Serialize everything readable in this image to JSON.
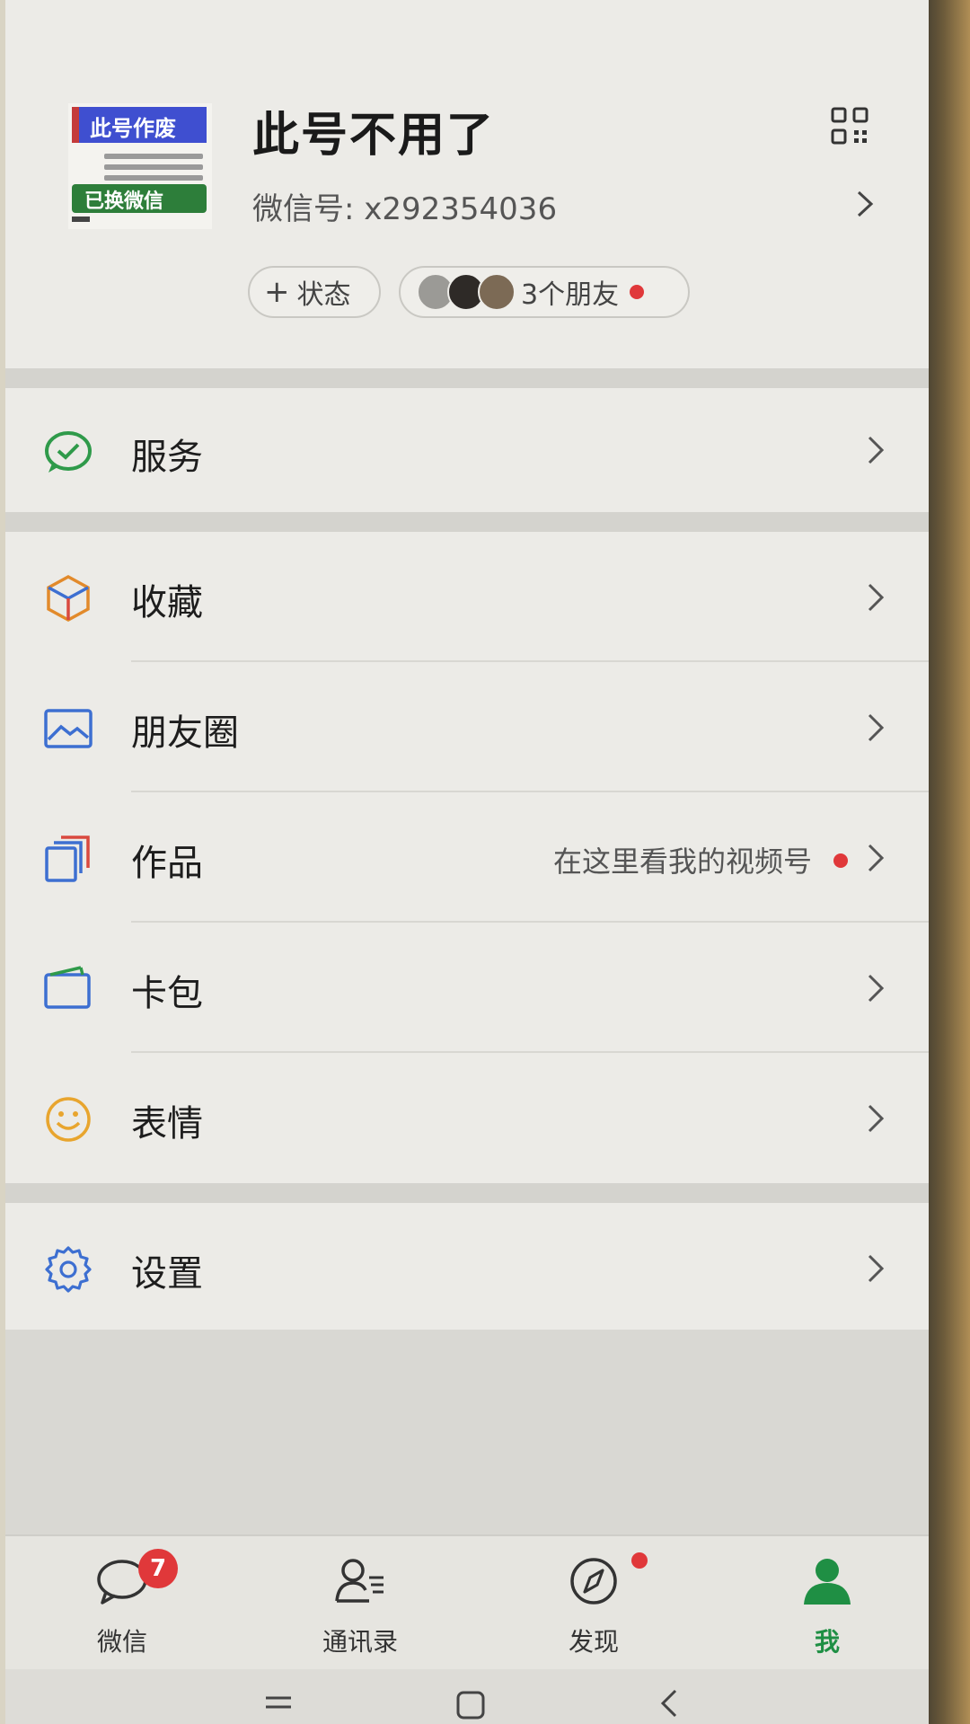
{
  "profile": {
    "nickname": "此号不用了",
    "wechat_id": "微信号: x292354036",
    "avatar_text_top": "此号作废",
    "avatar_text_bottom": "已换微信",
    "status_label": "状态",
    "friends_label": "3个朋友"
  },
  "menu": {
    "services": "服务",
    "favorites": "收藏",
    "moments": "朋友圈",
    "works": "作品",
    "works_hint": "在这里看我的视频号",
    "cards": "卡包",
    "stickers": "表情",
    "settings": "设置"
  },
  "tabbar": {
    "chats": "微信",
    "chats_badge": "7",
    "contacts": "通讯录",
    "discover": "发现",
    "me": "我"
  },
  "colors": {
    "accent_green": "#1f8f44",
    "badge_red": "#e0383a"
  }
}
